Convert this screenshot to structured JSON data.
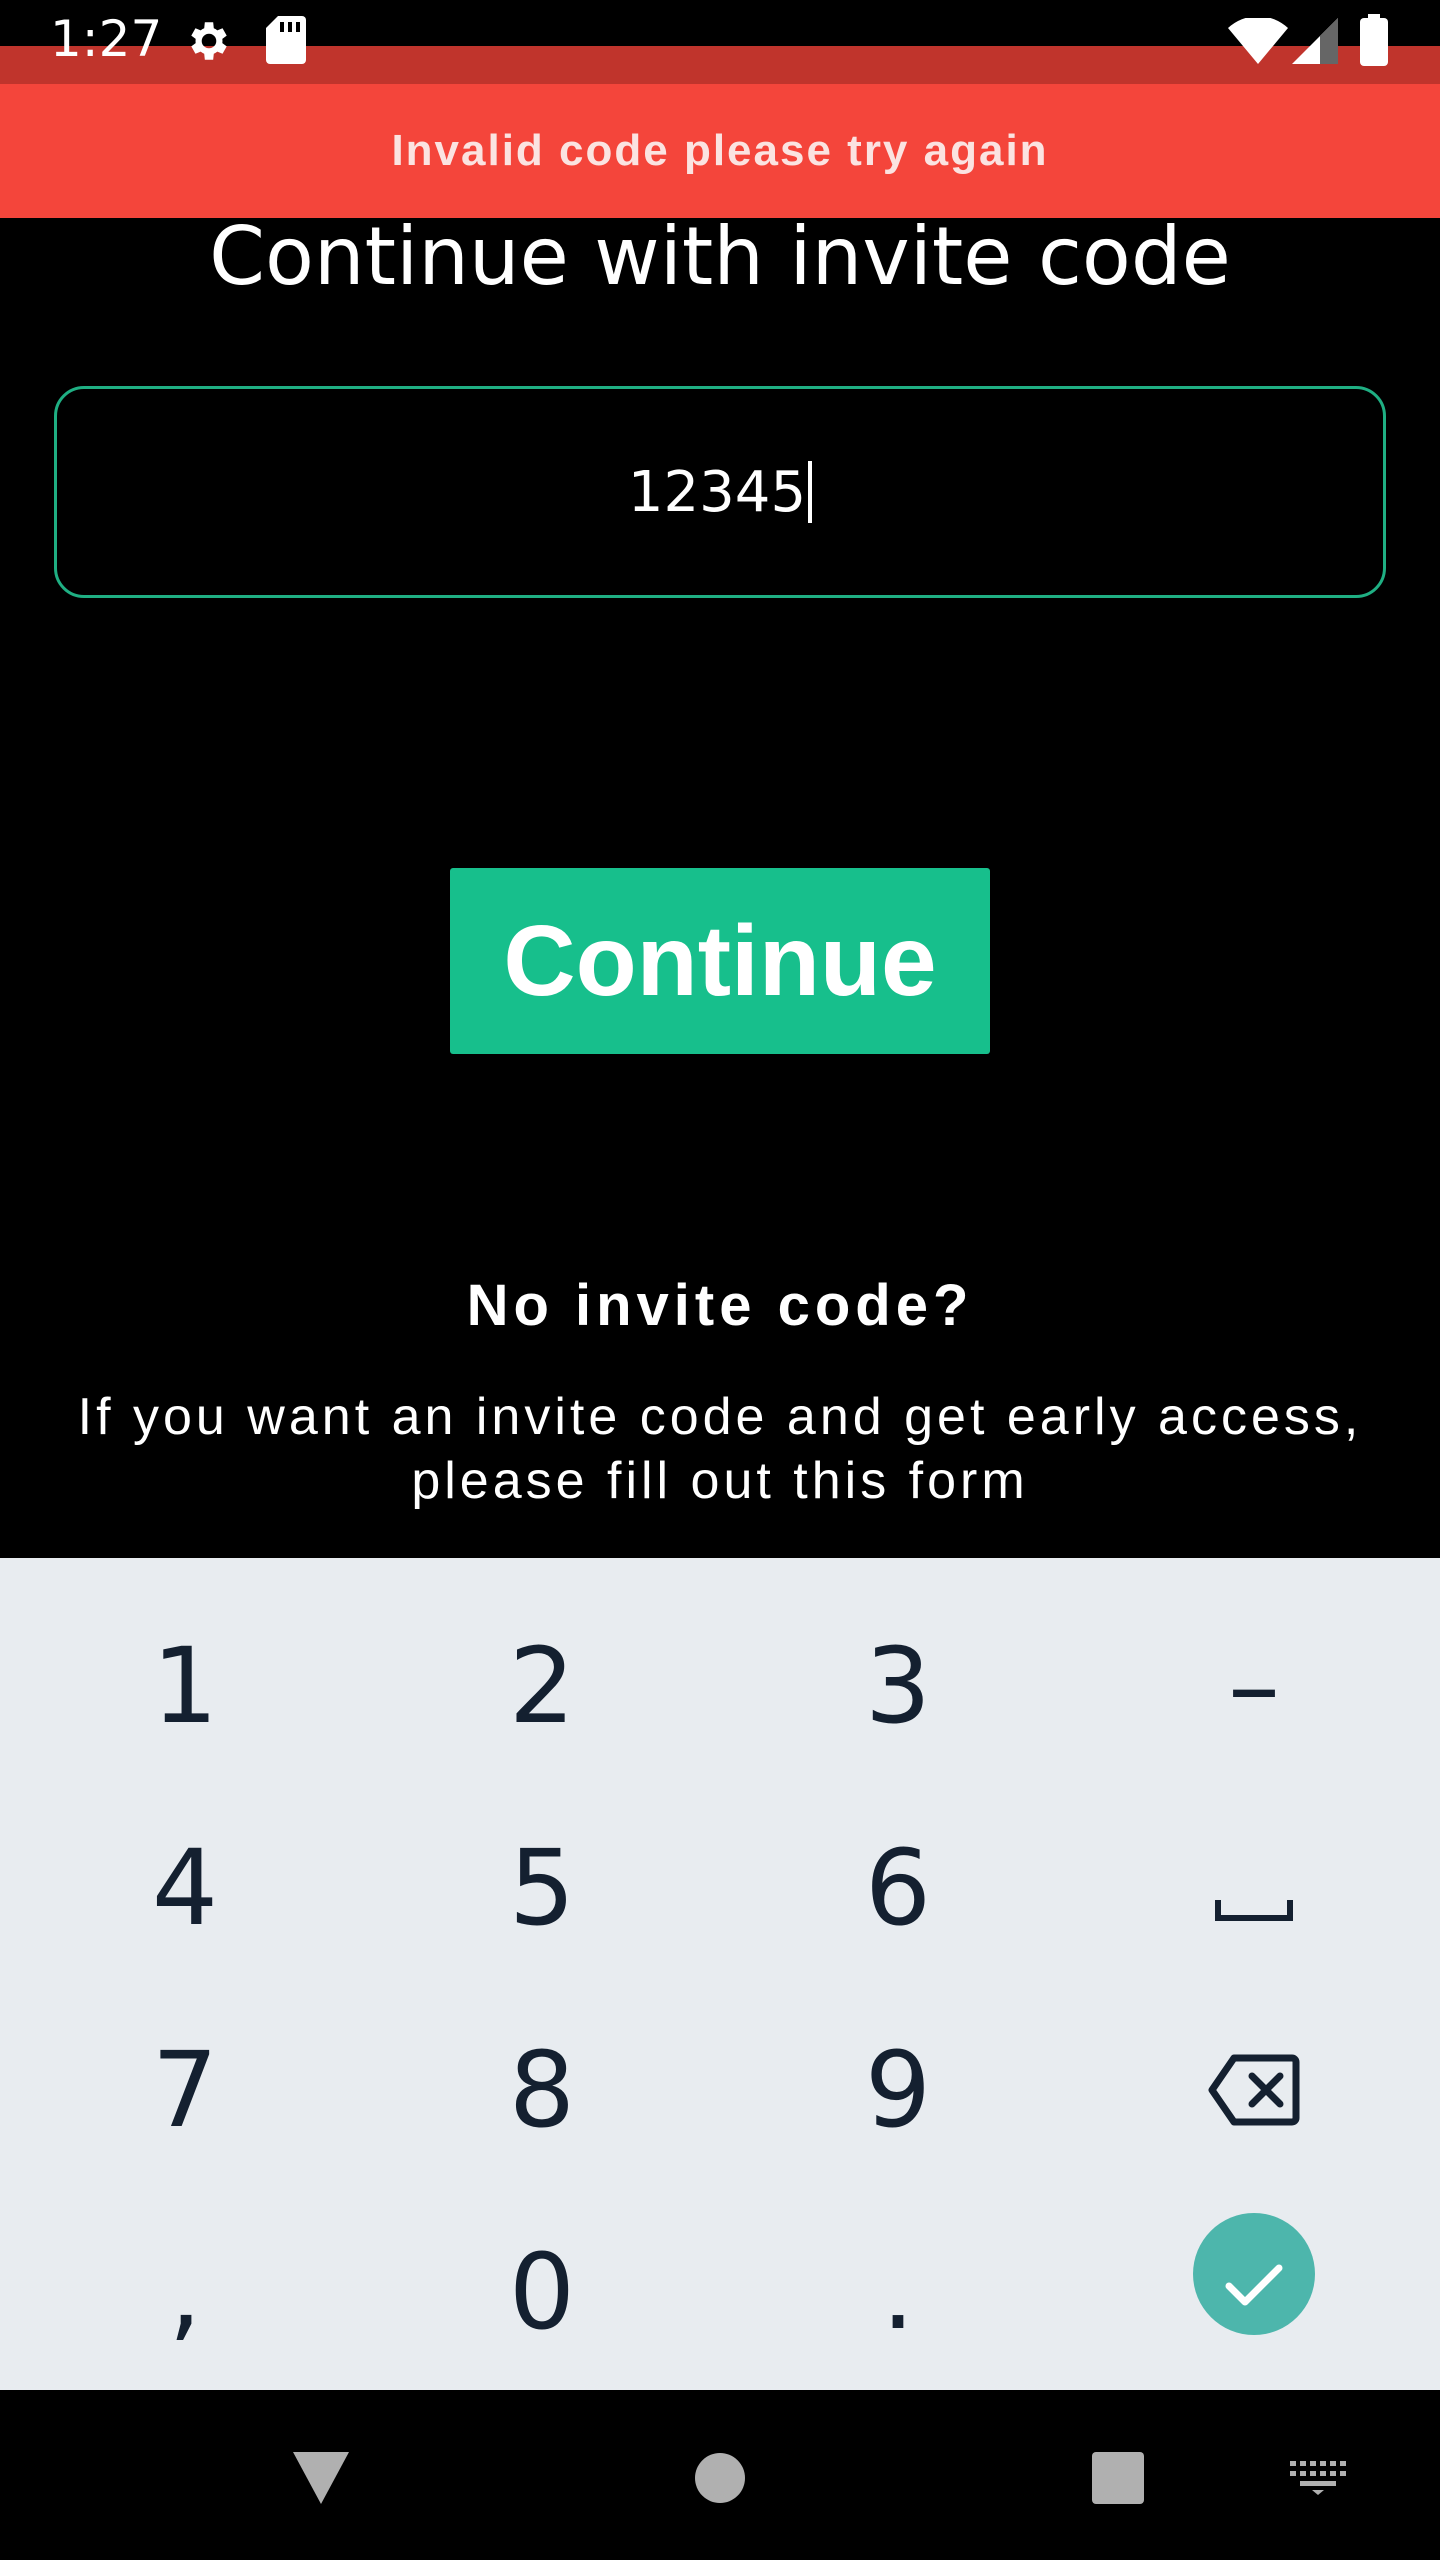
{
  "status_bar": {
    "time": "1:27",
    "icons": [
      "settings-icon",
      "sd-card-icon",
      "wifi-icon",
      "signal-icon",
      "battery-icon"
    ]
  },
  "banner": {
    "message": "Invalid code please try again",
    "color": "#f4453b"
  },
  "page": {
    "title": "Continue with invite code"
  },
  "invite_code": {
    "value": "12345",
    "border_color": "#1faf83"
  },
  "continue_button": {
    "label": "Continue",
    "color": "#17bf8c"
  },
  "no_invite": {
    "heading": "No invite code?",
    "line1": "If you want an invite code and get early access,",
    "line2": "please fill out this form"
  },
  "keyboard": {
    "keys": [
      [
        "1",
        "2",
        "3",
        "–"
      ],
      [
        "4",
        "5",
        "6",
        "space-icon"
      ],
      [
        "7",
        "8",
        "9",
        "backspace-icon"
      ],
      [
        ",",
        "0",
        ".",
        "done-check-icon"
      ]
    ],
    "row1": {
      "k1": "1",
      "k2": "2",
      "k3": "3",
      "k4": "–"
    },
    "row2": {
      "k1": "4",
      "k2": "5",
      "k3": "6"
    },
    "row3": {
      "k1": "7",
      "k2": "8",
      "k3": "9"
    },
    "row4": {
      "k1": ",",
      "k2": "0",
      "k3": "."
    },
    "done_color": "#4db6ac"
  },
  "nav_bar": {
    "buttons": [
      "back-icon",
      "home-icon",
      "recents-icon",
      "keyboard-switch-icon"
    ]
  }
}
